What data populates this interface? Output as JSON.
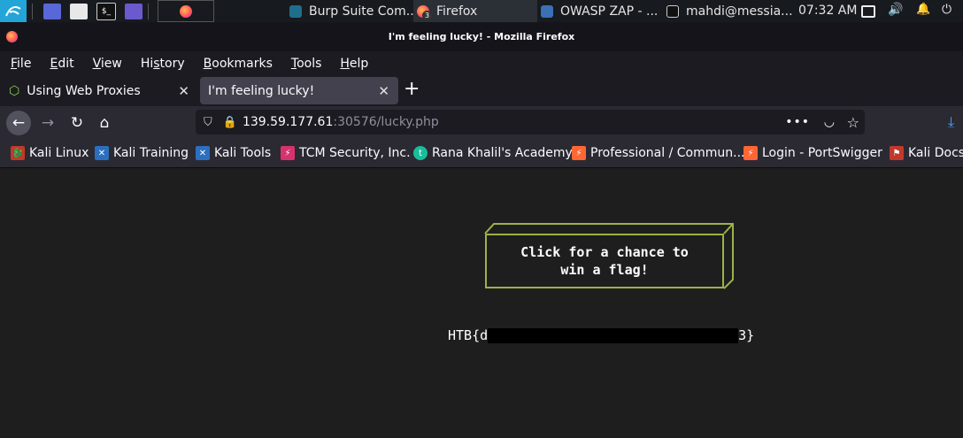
{
  "taskbar": {
    "tasks": [
      {
        "label": "Burp Suite Com...",
        "icon": "burp-icon",
        "color": "#1f6f8b"
      },
      {
        "label": "Firefox",
        "icon": "firefox-icon",
        "badge": "3"
      },
      {
        "label": "OWASP ZAP - ...",
        "icon": "zap-icon"
      },
      {
        "label": "mahdi@messia...",
        "icon": "terminal-icon"
      }
    ],
    "clock": "07:32 AM"
  },
  "window": {
    "title": "I'm feeling lucky! - Mozilla Firefox"
  },
  "menu": {
    "items": [
      {
        "label": "File",
        "accel": "F",
        "rest": "ile"
      },
      {
        "label": "Edit",
        "accel": "E",
        "rest": "dit"
      },
      {
        "label": "View",
        "accel": "V",
        "rest": "iew"
      },
      {
        "label": "History",
        "pre": "Hi",
        "accel": "s",
        "rest": "tory"
      },
      {
        "label": "Bookmarks",
        "accel": "B",
        "rest": "ookmarks"
      },
      {
        "label": "Tools",
        "accel": "T",
        "rest": "ools"
      },
      {
        "label": "Help",
        "accel": "H",
        "rest": "elp"
      }
    ]
  },
  "tabs": [
    {
      "label": "Using Web Proxies",
      "active": false,
      "icon": "cube-icon"
    },
    {
      "label": "I'm feeling lucky!",
      "active": true
    }
  ],
  "nav": {
    "url_host": "139.59.177.61",
    "url_rest": ":30576/lucky.php"
  },
  "bookmarks": [
    {
      "label": "Kali Linux",
      "icon": "kali-icon",
      "color": "#c0392b"
    },
    {
      "label": "Kali Training",
      "icon": "kali-training-icon",
      "color": "#2c6fbf"
    },
    {
      "label": "Kali Tools",
      "icon": "kali-tools-icon",
      "color": "#2c6fbf"
    },
    {
      "label": "TCM Security, Inc.",
      "icon": "tcm-icon",
      "color": "#d6336c"
    },
    {
      "label": "Rana Khalil's Academy",
      "icon": "rana-icon",
      "color": "#1abc9c"
    },
    {
      "label": "Professional / Commun...",
      "icon": "portswigger-icon",
      "color": "#ff6633"
    },
    {
      "label": "Login - PortSwigger",
      "icon": "portswigger-login-icon",
      "color": "#ff6633"
    },
    {
      "label": "Kali Docs",
      "icon": "kali-docs-icon",
      "color": "#c0392b"
    }
  ],
  "page": {
    "button_line1": "Click for a chance to",
    "button_line2": "win a flag!",
    "flag_prefix": "HTB{d",
    "flag_suffix": "3}"
  }
}
